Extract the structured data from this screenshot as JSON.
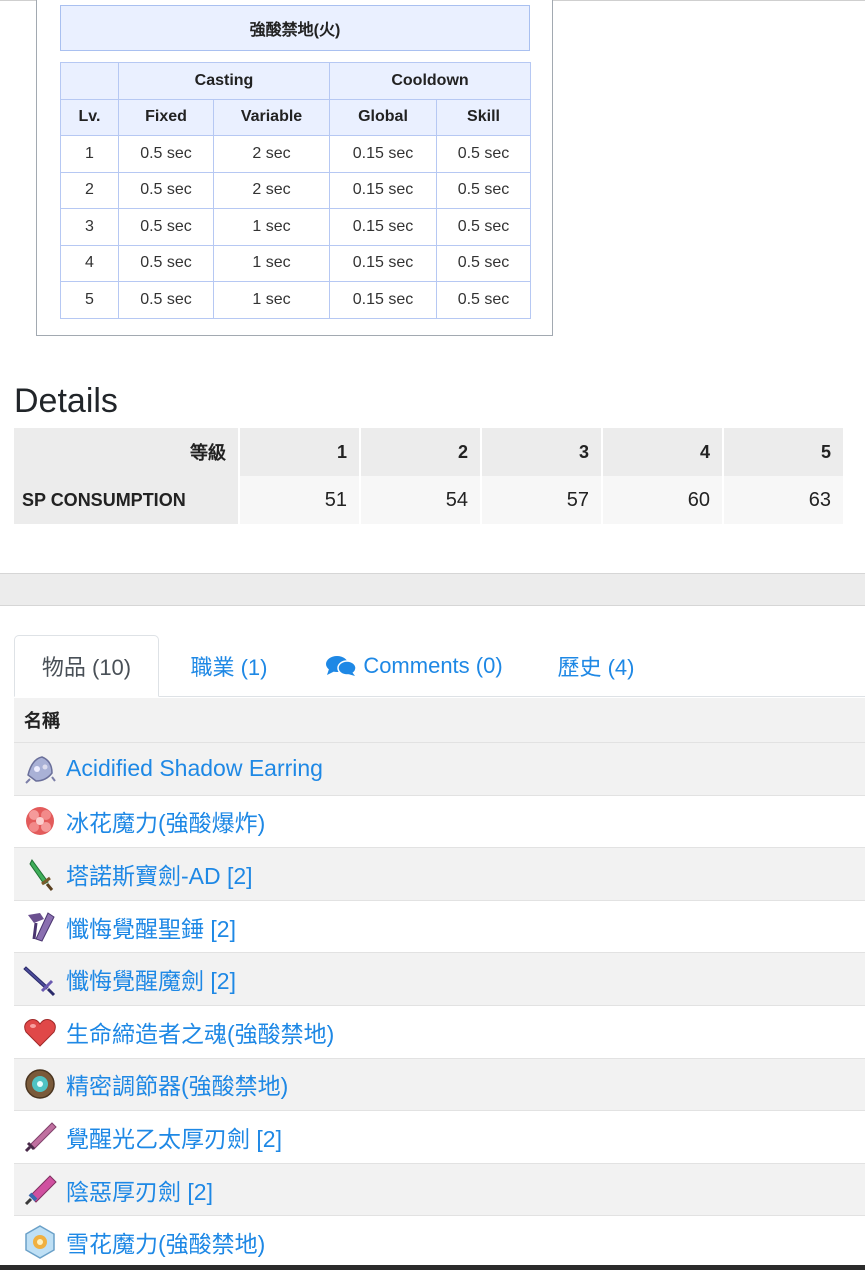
{
  "cast_table": {
    "title": "強酸禁地(火)",
    "group_headers": {
      "casting": "Casting",
      "cooldown": "Cooldown"
    },
    "columns": [
      "Lv.",
      "Fixed",
      "Variable",
      "Global",
      "Skill"
    ],
    "rows": [
      [
        "1",
        "0.5 sec",
        "2 sec",
        "0.15 sec",
        "0.5 sec"
      ],
      [
        "2",
        "0.5 sec",
        "2 sec",
        "0.15 sec",
        "0.5 sec"
      ],
      [
        "3",
        "0.5 sec",
        "1 sec",
        "0.15 sec",
        "0.5 sec"
      ],
      [
        "4",
        "0.5 sec",
        "1 sec",
        "0.15 sec",
        "0.5 sec"
      ],
      [
        "5",
        "0.5 sec",
        "1 sec",
        "0.15 sec",
        "0.5 sec"
      ]
    ]
  },
  "details": {
    "heading": "Details",
    "header_label": "等級",
    "levels": [
      "1",
      "2",
      "3",
      "4",
      "5"
    ],
    "row_label": "SP CONSUMPTION",
    "sp_values": [
      "51",
      "54",
      "57",
      "60",
      "63"
    ]
  },
  "tabs": [
    {
      "label": "物品 (10)",
      "active": true
    },
    {
      "label": "職業 (1)",
      "active": false
    },
    {
      "label": "Comments (0)",
      "active": false,
      "icon": "comments-icon"
    },
    {
      "label": "歷史 (4)",
      "active": false
    }
  ],
  "items": {
    "header": "名稱",
    "list": [
      {
        "name": "Acidified Shadow Earring",
        "icon": "earring-icon"
      },
      {
        "name": "冰花魔力(強酸爆炸)",
        "icon": "ice-flower-icon"
      },
      {
        "name": "塔諾斯寶劍-AD [2]",
        "icon": "green-sword-icon"
      },
      {
        "name": "懺悔覺醒聖錘 [2]",
        "icon": "hammer-icon"
      },
      {
        "name": "懺悔覺醒魔劍 [2]",
        "icon": "dark-sword-icon"
      },
      {
        "name": "生命締造者之魂(強酸禁地)",
        "icon": "heart-icon"
      },
      {
        "name": "精密調節器(強酸禁地)",
        "icon": "regulator-icon"
      },
      {
        "name": "覺醒光乙太厚刃劍 [2]",
        "icon": "light-blade-icon"
      },
      {
        "name": "陰惡厚刃劍 [2]",
        "icon": "sinister-blade-icon"
      },
      {
        "name": "雪花魔力(強酸禁地)",
        "icon": "snowflake-icon"
      }
    ]
  },
  "colors": {
    "link": "#1e88e5",
    "table_header_bg": "#eaf0ff",
    "table_border": "#b6c8f3"
  }
}
